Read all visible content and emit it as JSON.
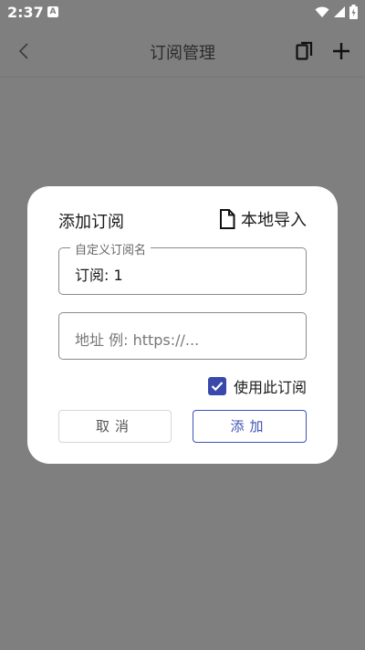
{
  "status_bar": {
    "time": "2:37",
    "notification_glyph": "A"
  },
  "app_bar": {
    "title": "订阅管理"
  },
  "dialog": {
    "title": "添加订阅",
    "import_label": "本地导入",
    "name_field": {
      "legend": "自定义订阅名",
      "value": "订阅: 1"
    },
    "url_field": {
      "placeholder": "地址 例: https://..."
    },
    "enable_label": "使用此订阅",
    "enabled": true,
    "cancel_label": "取消",
    "add_label": "添加"
  },
  "colors": {
    "scrim": "#7f7f7f",
    "accent": "#3f51b5",
    "checkbox": "#3949ab"
  }
}
